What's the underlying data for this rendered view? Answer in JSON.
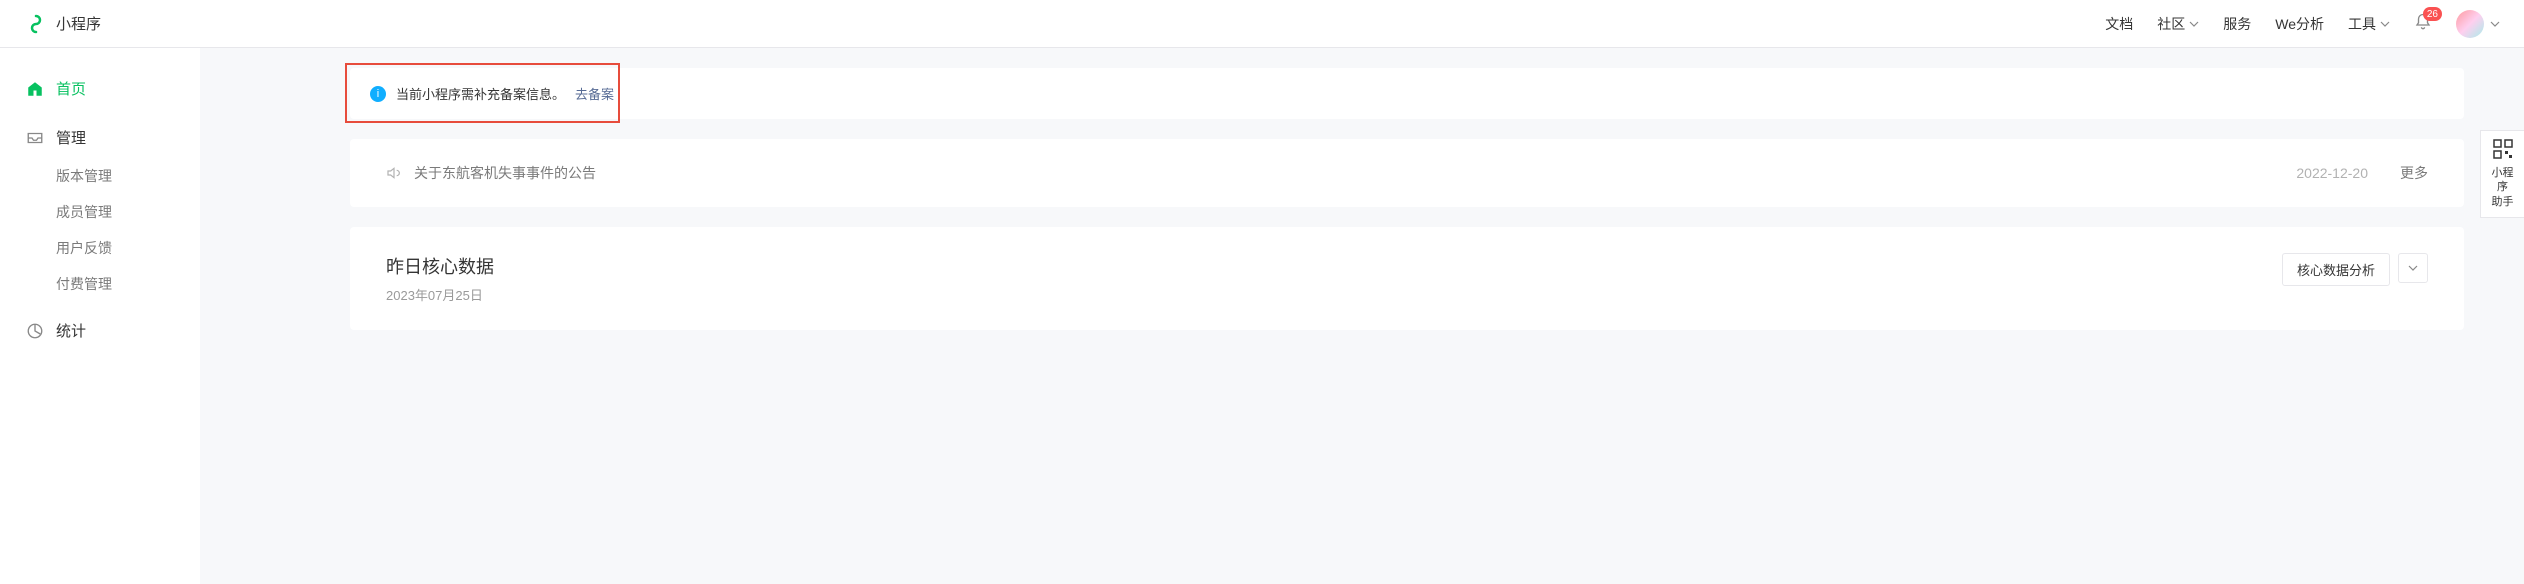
{
  "header": {
    "logo_text": "小程序",
    "nav": {
      "docs": "文档",
      "community": "社区",
      "service": "服务",
      "analytics": "We分析",
      "tools": "工具"
    },
    "badge_count": "26"
  },
  "sidebar": {
    "home": "首页",
    "manage": "管理",
    "manage_items": {
      "version": "版本管理",
      "members": "成员管理",
      "feedback": "用户反馈",
      "payment": "付费管理"
    },
    "stats": "统计"
  },
  "alert": {
    "text": "当前小程序需补充备案信息。",
    "link": "去备案"
  },
  "announce": {
    "text": "关于东航客机失事事件的公告",
    "date": "2022-12-20",
    "more": "更多"
  },
  "data_card": {
    "title": "昨日核心数据",
    "date": "2023年07月25日",
    "analysis_btn": "核心数据分析"
  },
  "float_helper": {
    "line1": "小程序",
    "line2": "助手"
  }
}
